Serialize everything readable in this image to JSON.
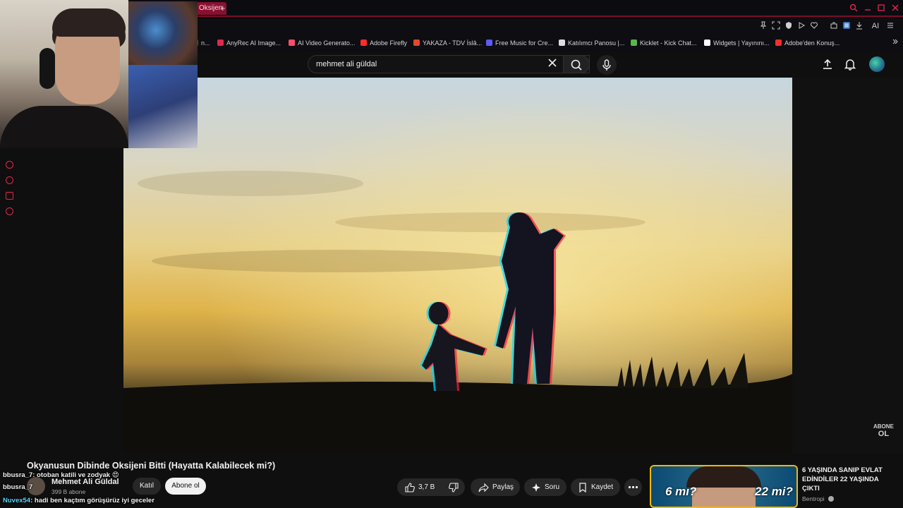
{
  "browser": {
    "active_tab_label": "Oksijen",
    "new_tab_symbol": "+",
    "toolbar_ai_label": "AI",
    "bookmarks": [
      {
        "label": "n...",
        "color": "#555555"
      },
      {
        "label": "AnyRec AI Image...",
        "color": "#e0284e"
      },
      {
        "label": "AI Video Generato...",
        "color": "#ff4d6d"
      },
      {
        "label": "Adobe Firefly",
        "color": "#ff2d2d"
      },
      {
        "label": "YAKAZA - TDV İslâ...",
        "color": "#e04a2a"
      },
      {
        "label": "Free Music for Cre...",
        "color": "#5b5bff"
      },
      {
        "label": "Katılımcı Panosu |...",
        "color": "#dddddd"
      },
      {
        "label": "Kicklet - Kick Chat...",
        "color": "#57b84a"
      },
      {
        "label": "Widgets | Yayınını...",
        "color": "#ffffff"
      },
      {
        "label": "Adobe'den Konuş...",
        "color": "#ff2d2d"
      }
    ]
  },
  "search": {
    "query": "mehmet ali güldal"
  },
  "video": {
    "watermark_line1": "ABONE",
    "watermark_line2": "OL",
    "title": "Okyanusun Dibinde Oksijeni Bitti (Hayatta Kalabilecek mi?)",
    "channel_name": "Mehmet Ali Güldal",
    "channel_subs": "399 B abone",
    "join_label": "Katıl",
    "subscribe_label": "Abone ol",
    "like_count": "3,7 B",
    "share_label": "Paylaş",
    "ask_label": "Soru",
    "save_label": "Kaydet"
  },
  "recommendation": {
    "title": "6 YAŞINDA SANIP EVLAT EDİNDİLER 22 YAŞINDA ÇIKTI",
    "channel": "Bentropi",
    "thumb_left_text": "6 mı?",
    "thumb_right_text": "22 mi?"
  },
  "chat": [
    {
      "user": "bbusra_7",
      "msg": ": otoban katili ve zodyak 😍"
    },
    {
      "user": "bbusra_7",
      "msg": ""
    },
    {
      "user": "Nuvex54",
      "msg": ": hadi ben kaçtım görüşürüz iyi geceler"
    }
  ],
  "colors": {
    "accent": "#e0284e",
    "subscribe_bg": "#f1f1f1",
    "thumb_border": "#f5b800"
  }
}
